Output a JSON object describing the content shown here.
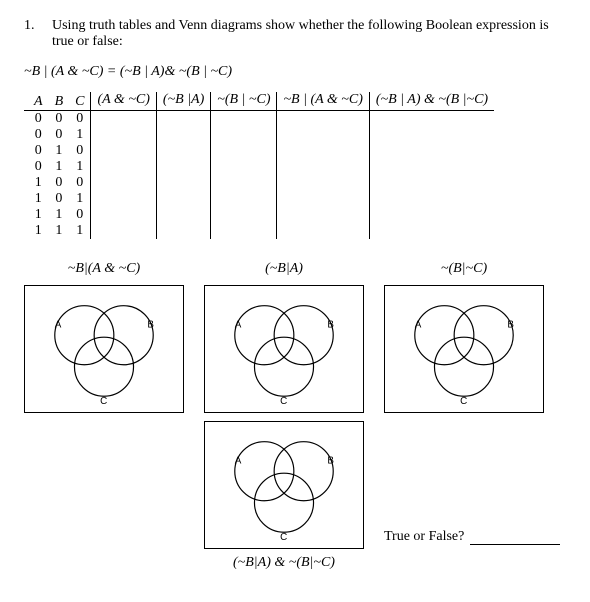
{
  "question": {
    "number": "1.",
    "text": "Using truth tables and Venn diagrams show whether the following Boolean expression is true or false:"
  },
  "expression": "~B | (A & ~C) = (~B | A)& ~(B | ~C)",
  "table_headers": {
    "a": "A",
    "b": "B",
    "c": "C",
    "col1": "(A & ~C)",
    "col2": "(~B |A)",
    "col3": "~(B | ~C)",
    "col4": "~B | (A & ~C)",
    "col5": "(~B | A) & ~(B |~C)"
  },
  "truth_rows": [
    {
      "a": "0",
      "b": "0",
      "c": "0"
    },
    {
      "a": "0",
      "b": "0",
      "c": "1"
    },
    {
      "a": "0",
      "b": "1",
      "c": "0"
    },
    {
      "a": "0",
      "b": "1",
      "c": "1"
    },
    {
      "a": "1",
      "b": "0",
      "c": "0"
    },
    {
      "a": "1",
      "b": "0",
      "c": "1"
    },
    {
      "a": "1",
      "b": "1",
      "c": "0"
    },
    {
      "a": "1",
      "b": "1",
      "c": "1"
    }
  ],
  "venn": {
    "a_label": "A",
    "b_label": "B",
    "c_label": "C",
    "top": {
      "l1": "~B|(A & ~C)",
      "l2": "(~B|A)",
      "l3": "~(B|~C)"
    },
    "bottom_label": "(~B|A) & ~(B|~C)"
  },
  "tf_prompt": "True or False?"
}
